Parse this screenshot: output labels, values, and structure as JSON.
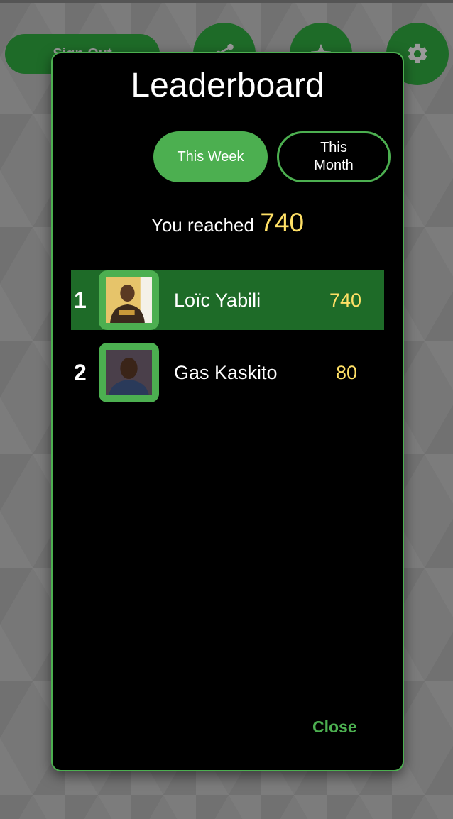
{
  "background": {
    "signout_label": "Sign Out",
    "icons": [
      "share-icon",
      "star-icon",
      "gear-icon"
    ]
  },
  "leaderboard": {
    "title": "Leaderboard",
    "tabs": [
      {
        "label": "This Week",
        "selected": true
      },
      {
        "label": "This\nMonth",
        "selected": false
      }
    ],
    "reached_label": "You reached",
    "reached_score": "740",
    "entries": [
      {
        "rank": "1",
        "name": "Loïc Yabili",
        "score": "740",
        "highlighted": true
      },
      {
        "rank": "2",
        "name": "Gas Kaskito",
        "score": "80",
        "highlighted": false
      }
    ],
    "close_label": "Close"
  },
  "colors": {
    "accent_green": "#4caf50",
    "dark_green": "#1e6b28",
    "score_yellow": "#ffe066",
    "modal_bg": "#000000"
  }
}
